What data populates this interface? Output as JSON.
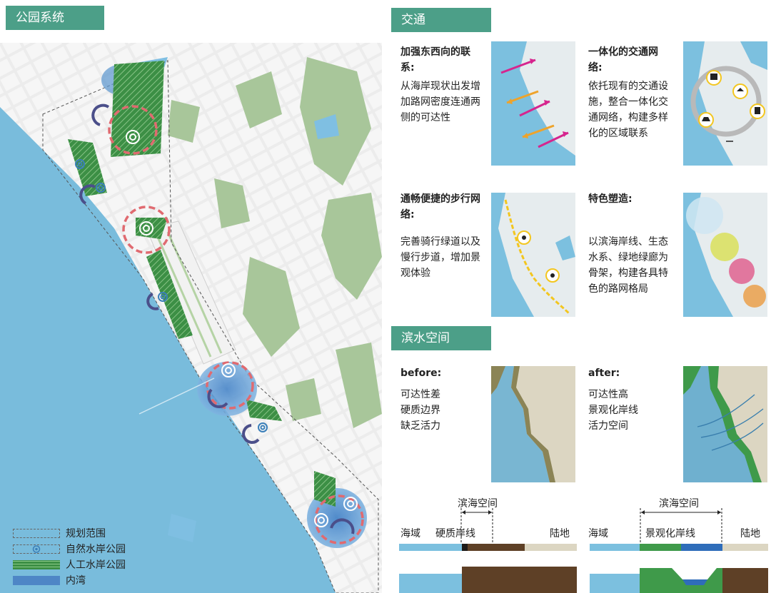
{
  "park_system": {
    "title": "公园系统",
    "legend": [
      {
        "label": "规划范围",
        "icon": "dashed-boundary"
      },
      {
        "label": "自然水岸公园",
        "icon": "concentric-circle-icon"
      },
      {
        "label": "人工水岸公园",
        "icon": "hatched-green"
      },
      {
        "label": "内湾",
        "icon": "blue-fill"
      }
    ]
  },
  "traffic": {
    "title": "交通",
    "panels": [
      {
        "title": "加强东西向的联系:",
        "body": "从海岸现状出发增加路网密度连通两侧的可达性"
      },
      {
        "title": "一体化的交通网络:",
        "body": "依托现有的交通设施，整合一体化交通网络，构建多样化的区域联系"
      },
      {
        "title": "通畅便捷的步行网络:",
        "body": "完善骑行绿道以及慢行步道，增加景观体验"
      },
      {
        "title": "特色塑造:",
        "body": "以滨海岸线、生态水系、绿地绿廊为骨架，构建各具特色的路网格局"
      }
    ]
  },
  "waterfront": {
    "title": "滨水空间",
    "before": {
      "title": "before:",
      "lines": [
        "可达性差",
        "硬质边界",
        "缺乏活力"
      ]
    },
    "after": {
      "title": "after:",
      "lines": [
        "可达性高",
        "景观化岸线",
        "活力空间"
      ]
    },
    "section_before": {
      "space": "滨海空间",
      "sea": "海域",
      "shore": "硬质岸线",
      "land": "陆地"
    },
    "section_after": {
      "space": "滨海空间",
      "sea": "海域",
      "shore": "景观化岸线",
      "land": "陆地"
    }
  },
  "colors": {
    "teal": "#4c9f88",
    "sea": "#7fc0de",
    "green": "#3f9a4a",
    "brown": "#5e4026",
    "khaki": "#8b8456",
    "tan": "#dcd6c2"
  }
}
